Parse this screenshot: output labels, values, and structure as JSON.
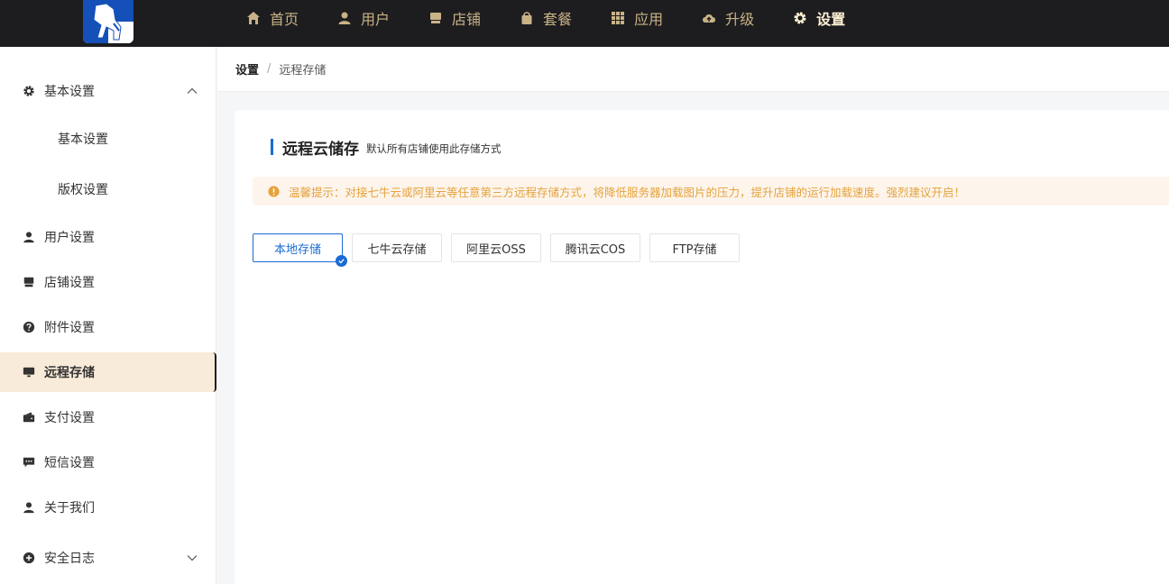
{
  "nav": {
    "items": [
      {
        "label": "首页",
        "icon": "home-icon"
      },
      {
        "label": "用户",
        "icon": "user-icon"
      },
      {
        "label": "店铺",
        "icon": "store-icon"
      },
      {
        "label": "套餐",
        "icon": "bag-icon"
      },
      {
        "label": "应用",
        "icon": "grid-icon"
      },
      {
        "label": "升级",
        "icon": "cloud-upload-icon"
      },
      {
        "label": "设置",
        "icon": "gear-icon"
      }
    ],
    "active_color": "#fff2d6",
    "color": "#c9b287"
  },
  "sidebar": {
    "basic": {
      "label": "基本设置",
      "sub": [
        "基本设置",
        "版权设置"
      ]
    },
    "items": [
      {
        "label": "用户设置"
      },
      {
        "label": "店铺设置"
      },
      {
        "label": "附件设置"
      },
      {
        "label": "远程存储"
      },
      {
        "label": "支付设置"
      },
      {
        "label": "短信设置"
      },
      {
        "label": "关于我们"
      },
      {
        "label": "安全日志"
      }
    ],
    "active_bg": "#f8ebd9"
  },
  "breadcrumb": {
    "root": "设置",
    "separator": "/",
    "current": "远程存储"
  },
  "main": {
    "title": "远程云储存",
    "subtitle": "默认所有店铺使用此存储方式",
    "tip": "温馨提示：对接七牛云或阿里云等任意第三方远程存储方式，将降低服务器加载图片的压力，提升店铺的运行加载速度。强烈建议开启！",
    "options": [
      "本地存储",
      "七牛云存储",
      "阿里云OSS",
      "腾讯云COS",
      "FTP存储"
    ],
    "selected_option": "本地存储",
    "accent": "#1a6bd6",
    "tip_color": "#e6a23c"
  }
}
